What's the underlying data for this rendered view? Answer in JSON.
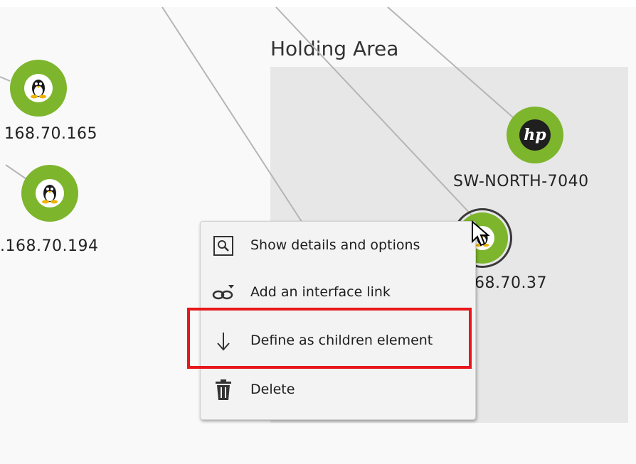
{
  "canvas": {
    "group_title": "Holding Area",
    "colors": {
      "node_green": "#7db52c",
      "holding_area_bg": "#e7e7e7",
      "highlight_red": "#e8171b",
      "link_gray": "#b5b5b5"
    }
  },
  "nodes": [
    {
      "label": "168.70.165",
      "icon": "linux-tux-icon"
    },
    {
      "label": ".168.70.194",
      "icon": "linux-tux-icon"
    },
    {
      "label": "SW-NORTH-7040",
      "icon": "hp-logo-icon"
    },
    {
      "label": "68.70.37",
      "icon": "linux-tux-icon",
      "selected": true
    }
  ],
  "context_menu": {
    "items": [
      {
        "label": "Show details and options",
        "icon": "magnifier-icon"
      },
      {
        "label": "Add an interface link",
        "icon": "link-add-icon"
      },
      {
        "label": "Define as children element",
        "icon": "arrow-down-icon",
        "highlighted": true
      },
      {
        "label": "Delete",
        "icon": "trash-icon"
      }
    ]
  }
}
